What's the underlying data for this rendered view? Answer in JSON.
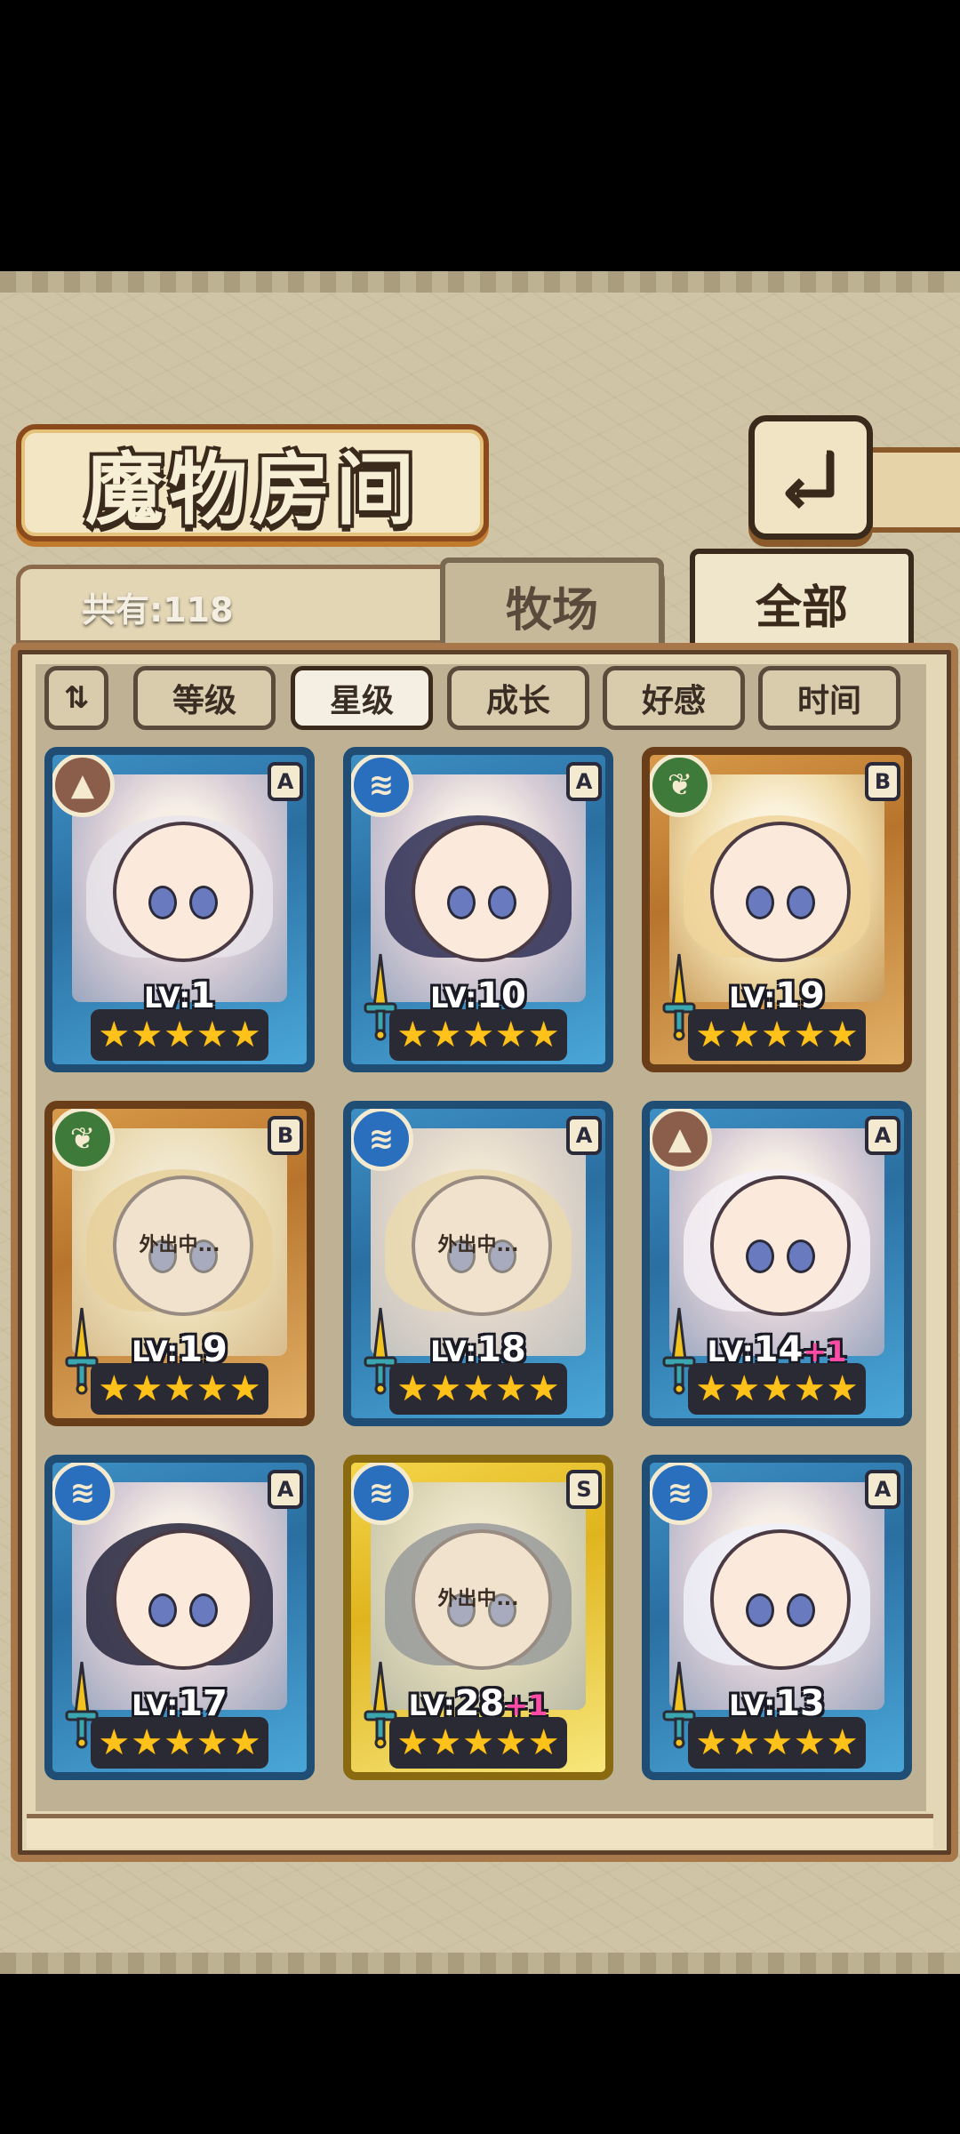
{
  "header": {
    "title": "魔物房间",
    "back_icon": "return-arrow-icon"
  },
  "count": {
    "label": "共有:118"
  },
  "tabs": [
    {
      "label": "牧场",
      "active": false
    },
    {
      "label": "全部",
      "active": true
    }
  ],
  "sort": {
    "order_icon": "sort-order-icon",
    "order_glyph": "⇅",
    "buttons": [
      {
        "label": "等级",
        "active": false
      },
      {
        "label": "星级",
        "active": true
      },
      {
        "label": "成长",
        "active": false
      },
      {
        "label": "好感",
        "active": false
      },
      {
        "label": "时间",
        "active": false
      }
    ]
  },
  "monsters": [
    {
      "element": "earth",
      "rank": "A",
      "level_label": "LV:",
      "level": "1",
      "bonus": "",
      "stars": 5,
      "away": "",
      "weapon": false
    },
    {
      "element": "water",
      "rank": "A",
      "level_label": "LV:",
      "level": "10",
      "bonus": "",
      "stars": 5,
      "away": "",
      "weapon": true
    },
    {
      "element": "wood",
      "rank": "B",
      "level_label": "LV:",
      "level": "19",
      "bonus": "",
      "stars": 5,
      "away": "",
      "weapon": true
    },
    {
      "element": "wood",
      "rank": "B",
      "level_label": "LV:",
      "level": "19",
      "bonus": "",
      "stars": 5,
      "away": "外出中...",
      "weapon": true
    },
    {
      "element": "water",
      "rank": "A",
      "level_label": "LV:",
      "level": "18",
      "bonus": "",
      "stars": 5,
      "away": "外出中...",
      "weapon": true
    },
    {
      "element": "earth",
      "rank": "A",
      "level_label": "LV:",
      "level": "14",
      "bonus": "+1",
      "stars": 5,
      "away": "",
      "weapon": true
    },
    {
      "element": "water",
      "rank": "A",
      "level_label": "LV:",
      "level": "17",
      "bonus": "",
      "stars": 5,
      "away": "",
      "weapon": true
    },
    {
      "element": "water",
      "rank": "S",
      "level_label": "LV:",
      "level": "28",
      "bonus": "+1",
      "stars": 5,
      "away": "外出中...",
      "weapon": true
    },
    {
      "element": "water",
      "rank": "A",
      "level_label": "LV:",
      "level": "13",
      "bonus": "",
      "stars": 5,
      "away": "",
      "weapon": true
    }
  ],
  "colors": {
    "rank_A_frame": "#2a6fa2",
    "rank_B_frame": "#b8742c",
    "rank_S_frame": "#e0b41e",
    "star": "#ffc21a",
    "bonus_text": "#ff4aa6"
  }
}
